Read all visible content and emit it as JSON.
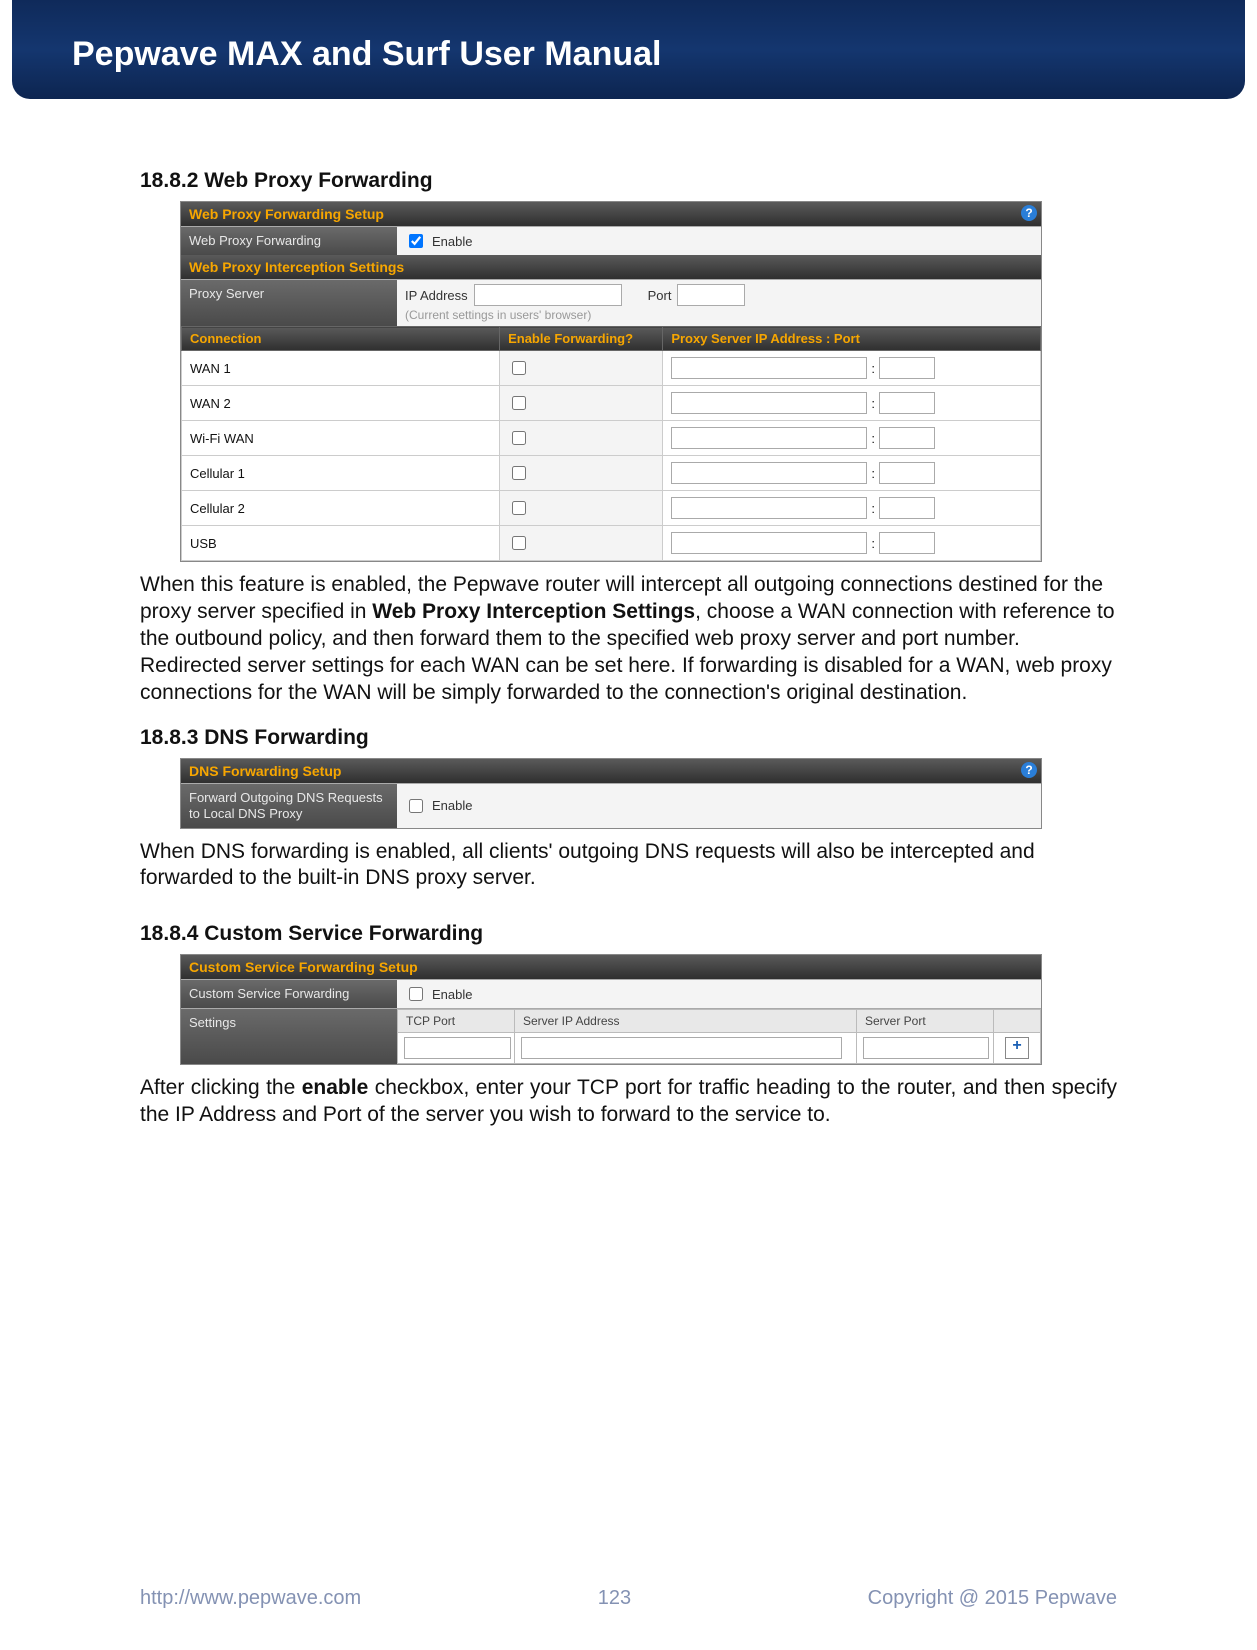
{
  "header": {
    "title": "Pepwave MAX and Surf User Manual"
  },
  "sections": {
    "s1": {
      "num": "18.8.2",
      "title": "Web Proxy Forwarding",
      "panel": {
        "header1": "Web Proxy Forwarding Setup",
        "row1_label": "Web Proxy Forwarding",
        "row1_enable": "Enable",
        "header2": "Web Proxy Interception Settings",
        "row2_label": "Proxy Server",
        "row2_ip_label": "IP Address",
        "row2_port_label": "Port",
        "row2_hint": "(Current settings in users' browser)",
        "conn_headers": {
          "c1": "Connection",
          "c2": "Enable Forwarding?",
          "c3": "Proxy Server IP Address : Port"
        },
        "connections": [
          "WAN 1",
          "WAN 2",
          "Wi-Fi WAN",
          "Cellular 1",
          "Cellular 2",
          "USB"
        ]
      },
      "para_pre": "When this feature is enabled, the Pepwave router will intercept all outgoing connections destined for the proxy server specified in ",
      "para_bold": "Web Proxy Interception Settings",
      "para_post": ", choose a WAN connection with reference to the outbound policy, and then forward them to the specified web proxy server and port number. Redirected server settings for each WAN can be set here. If forwarding is disabled for a WAN, web proxy connections for the WAN will be simply forwarded to the connection's original destination."
    },
    "s2": {
      "num": "18.8.3",
      "title": "DNS Forwarding",
      "panel": {
        "header": "DNS Forwarding Setup",
        "row_label": "Forward Outgoing DNS Requests to Local DNS Proxy",
        "enable": "Enable"
      },
      "para": "When DNS forwarding is enabled, all clients' outgoing DNS requests will also be intercepted and forwarded to the built-in DNS proxy server."
    },
    "s3": {
      "num": "18.8.4",
      "title": "Custom Service Forwarding",
      "panel": {
        "header": "Custom Service Forwarding Setup",
        "row1_label": "Custom Service Forwarding",
        "row1_enable": "Enable",
        "row2_label": "Settings",
        "cols": {
          "c1": "TCP Port",
          "c2": "Server IP Address",
          "c3": "Server Port"
        }
      },
      "para_pre": "After clicking the ",
      "para_bold": "enable",
      "para_post": " checkbox, enter your TCP port for traffic heading to the router, and then specify the IP Address and Port of the server you wish to forward to the service to."
    }
  },
  "footer": {
    "url": "http://www.pepwave.com",
    "page": "123",
    "copyright": "Copyright @ 2015 Pepwave"
  }
}
